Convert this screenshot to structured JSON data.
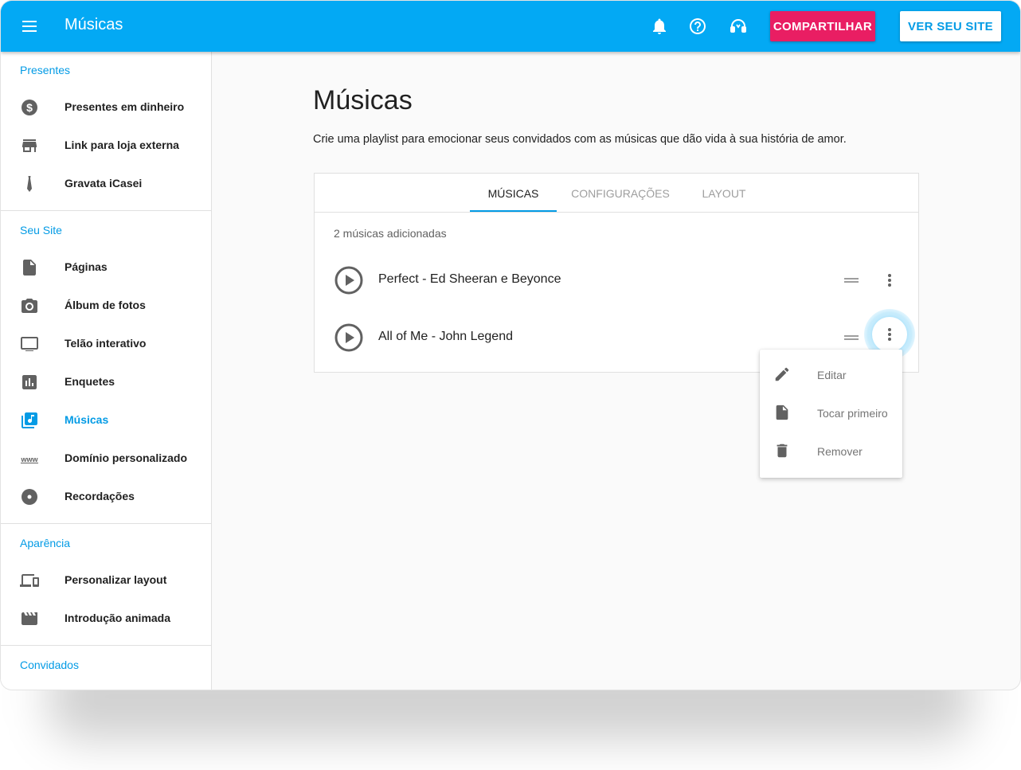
{
  "header": {
    "title": "Músicas",
    "share_label": "COMPARTILHAR",
    "view_site_label": "VER SEU SITE",
    "icons": [
      "menu-icon",
      "bell-icon",
      "help-icon",
      "support-icon"
    ]
  },
  "sidebar": {
    "sections": [
      {
        "title": "Presentes",
        "items": [
          {
            "label": "Presentes em dinheiro",
            "icon": "dollar-icon"
          },
          {
            "label": "Link para loja externa",
            "icon": "store-icon"
          },
          {
            "label": "Gravata iCasei",
            "icon": "tie-icon"
          }
        ]
      },
      {
        "title": "Seu Site",
        "items": [
          {
            "label": "Páginas",
            "icon": "page-icon"
          },
          {
            "label": "Álbum de fotos",
            "icon": "camera-icon"
          },
          {
            "label": "Telão interativo",
            "icon": "screen-icon"
          },
          {
            "label": "Enquetes",
            "icon": "poll-icon"
          },
          {
            "label": "Músicas",
            "icon": "music-library-icon",
            "active": true
          },
          {
            "label": "Domínio personalizado",
            "icon": "www-icon"
          },
          {
            "label": "Recordações",
            "icon": "disc-icon"
          }
        ]
      },
      {
        "title": "Aparência",
        "items": [
          {
            "label": "Personalizar layout",
            "icon": "devices-icon"
          },
          {
            "label": "Introdução animada",
            "icon": "movie-icon"
          }
        ]
      },
      {
        "title": "Convidados",
        "items": []
      }
    ]
  },
  "main": {
    "title": "Músicas",
    "description": "Crie uma playlist para emocionar seus convidados com as músicas que dão vida à sua história de amor.",
    "tabs": [
      {
        "label": "MÚSICAS",
        "active": true
      },
      {
        "label": "CONFIGURAÇÕES",
        "active": false
      },
      {
        "label": "LAYOUT",
        "active": false
      }
    ],
    "count_text": "2 músicas adicionadas",
    "songs": [
      {
        "title": "Perfect - Ed Sheeran e Beyonce"
      },
      {
        "title": "All of Me - John Legend"
      }
    ]
  },
  "context_menu": {
    "items": [
      {
        "label": "Editar",
        "icon": "pencil-icon"
      },
      {
        "label": "Tocar primeiro",
        "icon": "file-icon"
      },
      {
        "label": "Remover",
        "icon": "trash-icon"
      }
    ]
  },
  "colors": {
    "primary": "#03a9f4",
    "accent": "#e91e63",
    "active_text": "#039be5"
  }
}
